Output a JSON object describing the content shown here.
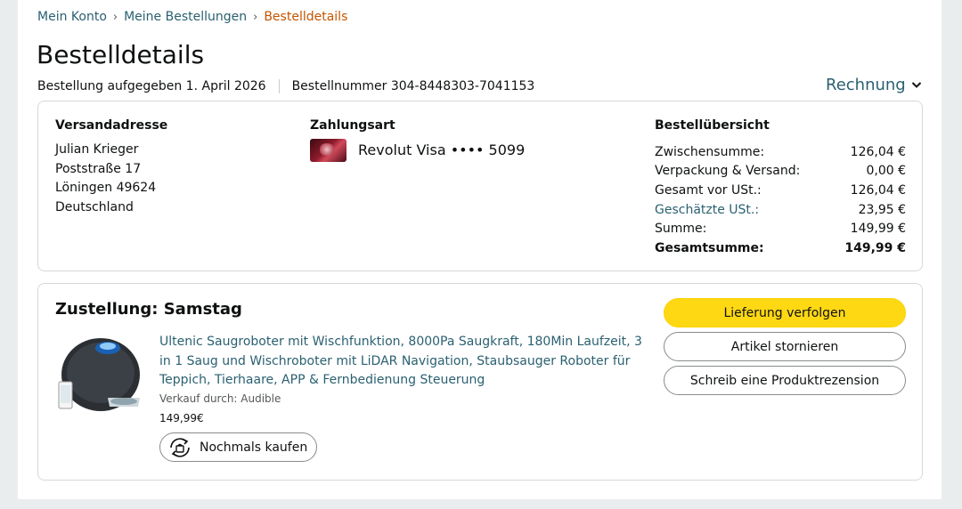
{
  "breadcrumb": {
    "items": [
      "Mein Konto",
      "Meine Bestellungen"
    ],
    "separator": "›",
    "current": "Bestelldetails"
  },
  "title": "Bestelldetails",
  "meta": {
    "placed": "Bestellung aufgegeben 1. April 2026",
    "order_number": "Bestellnummer 304-8448303-7041153"
  },
  "invoice": {
    "label": "Rechnung",
    "icon": "chevron-down-icon"
  },
  "shipping": {
    "heading": "Versandadresse",
    "lines": [
      "Julian Krieger",
      "Poststraße 17",
      "Löningen 49624",
      "Deutschland"
    ]
  },
  "payment": {
    "heading": "Zahlungsart",
    "card_label": "Revolut Visa •••• 5099",
    "card_icon": "credit-card-icon"
  },
  "summary": {
    "heading": "Bestellübersicht",
    "rows": [
      {
        "label": "Zwischensumme:",
        "value": "126,04 €"
      },
      {
        "label": "Verpackung & Versand:",
        "value": "0,00 €"
      },
      {
        "label": "Gesamt vor USt.:",
        "value": "126,04 €"
      },
      {
        "label": "Geschätzte USt.:",
        "value": "23,95 €"
      },
      {
        "label": "Summe:",
        "value": "149,99 €"
      },
      {
        "label": "Gesamtsumme:",
        "value": "149,99 €"
      }
    ]
  },
  "delivery": {
    "heading": "Zustellung: Samstag",
    "product": {
      "title": "Ultenic Saugroboter mit Wischfunktion, 8000Pa Saugkraft, 180Min Laufzeit, 3 in 1 Saug und Wischroboter mit LiDAR Navigation, Staubsauger Roboter für Teppich, Tierhaare, APP & Fernbedienung Steuerung",
      "sold_by": "Verkauf durch: Audible",
      "price": "149,99€",
      "image_icon": "robot-vacuum-image",
      "rebuy_label": "Nochmals kaufen",
      "rebuy_icon": "rebuy-icon"
    },
    "buttons": {
      "track": "Lieferung verfolgen",
      "cancel": "Artikel stornieren",
      "review": "Schreib eine Produktrezension"
    }
  },
  "colors": {
    "link": "#2a6071",
    "breadcrumb_current": "#c45500",
    "primary_button": "#ffd814",
    "page_bg": "#eaeded"
  }
}
